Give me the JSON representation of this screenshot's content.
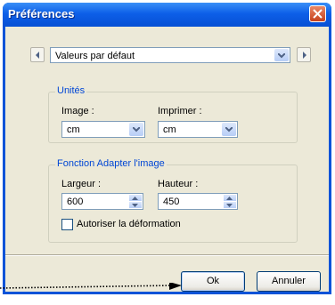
{
  "dialog": {
    "title": "Préférences",
    "preset": "Valeurs par défaut",
    "units_group": {
      "title": "Unités",
      "image_label": "Image :",
      "image_value": "cm",
      "print_label": "Imprimer :",
      "print_value": "cm"
    },
    "fit_group": {
      "title": "Fonction Adapter l'image",
      "width_label": "Largeur :",
      "width_value": "600",
      "height_label": "Hauteur :",
      "height_value": "450",
      "deform_label": "Autoriser la déformation",
      "deform_checked": false
    },
    "buttons": {
      "ok": "Ok",
      "cancel": "Annuler"
    }
  },
  "icons": [
    "close-icon",
    "arrow-left-icon",
    "arrow-right-icon",
    "chevron-down-icon",
    "spin-up-icon",
    "spin-down-icon"
  ],
  "colors": {
    "titlebar": "#0d5fe8",
    "dialog_bg": "#ece9d8",
    "group_title": "#0046d5",
    "close": "#c6411d"
  }
}
